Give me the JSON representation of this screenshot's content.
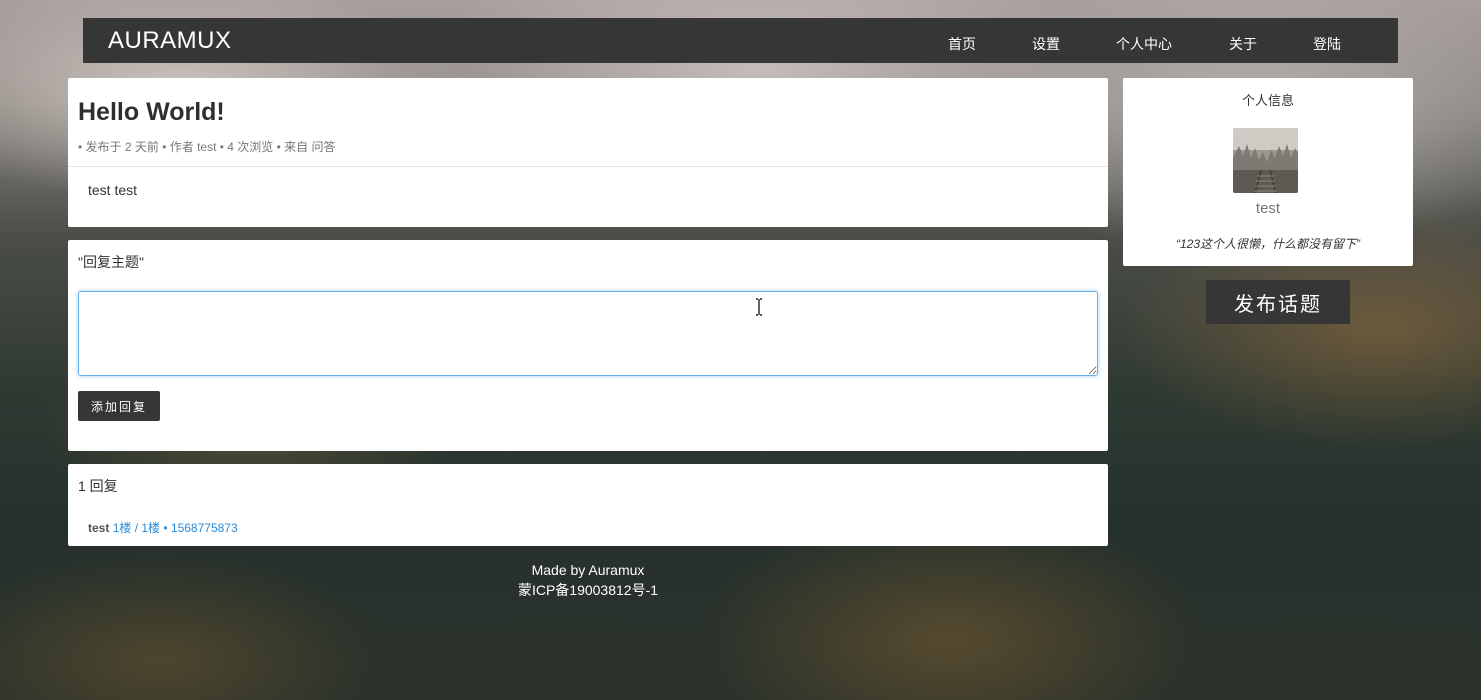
{
  "navbar": {
    "brand": "AURAMUX",
    "items": [
      {
        "label": "首页"
      },
      {
        "label": "设置"
      },
      {
        "label": "个人中心"
      },
      {
        "label": "关于"
      },
      {
        "label": "登陆"
      }
    ]
  },
  "post": {
    "title": "Hello World!",
    "meta": "• 发布于 2 天前 • 作者 test • 4 次浏览 • 来自 问答",
    "body": "test test"
  },
  "reply_form": {
    "heading": "\"回复主题\"",
    "textarea_value": "",
    "submit_label": "添加回复"
  },
  "replies": {
    "count_label": "1 回复",
    "items": [
      {
        "author": "test",
        "meta": "1楼 / 1楼 • 1568775873"
      }
    ]
  },
  "footer": {
    "made_by": "Made by Auramux",
    "icp": "蒙ICP备19003812号-1"
  },
  "profile": {
    "heading": "个人信息",
    "username": "test",
    "bio": "“123这个人很懒，什么都没有留下”"
  },
  "new_topic_label": "发布话题",
  "icons": {
    "avatar": "avatar-image-railway-forest",
    "cursor": "text-cursor-icon"
  },
  "colors": {
    "dark": "#363636",
    "link": "#2a8ad6",
    "focus": "#66afe9"
  }
}
